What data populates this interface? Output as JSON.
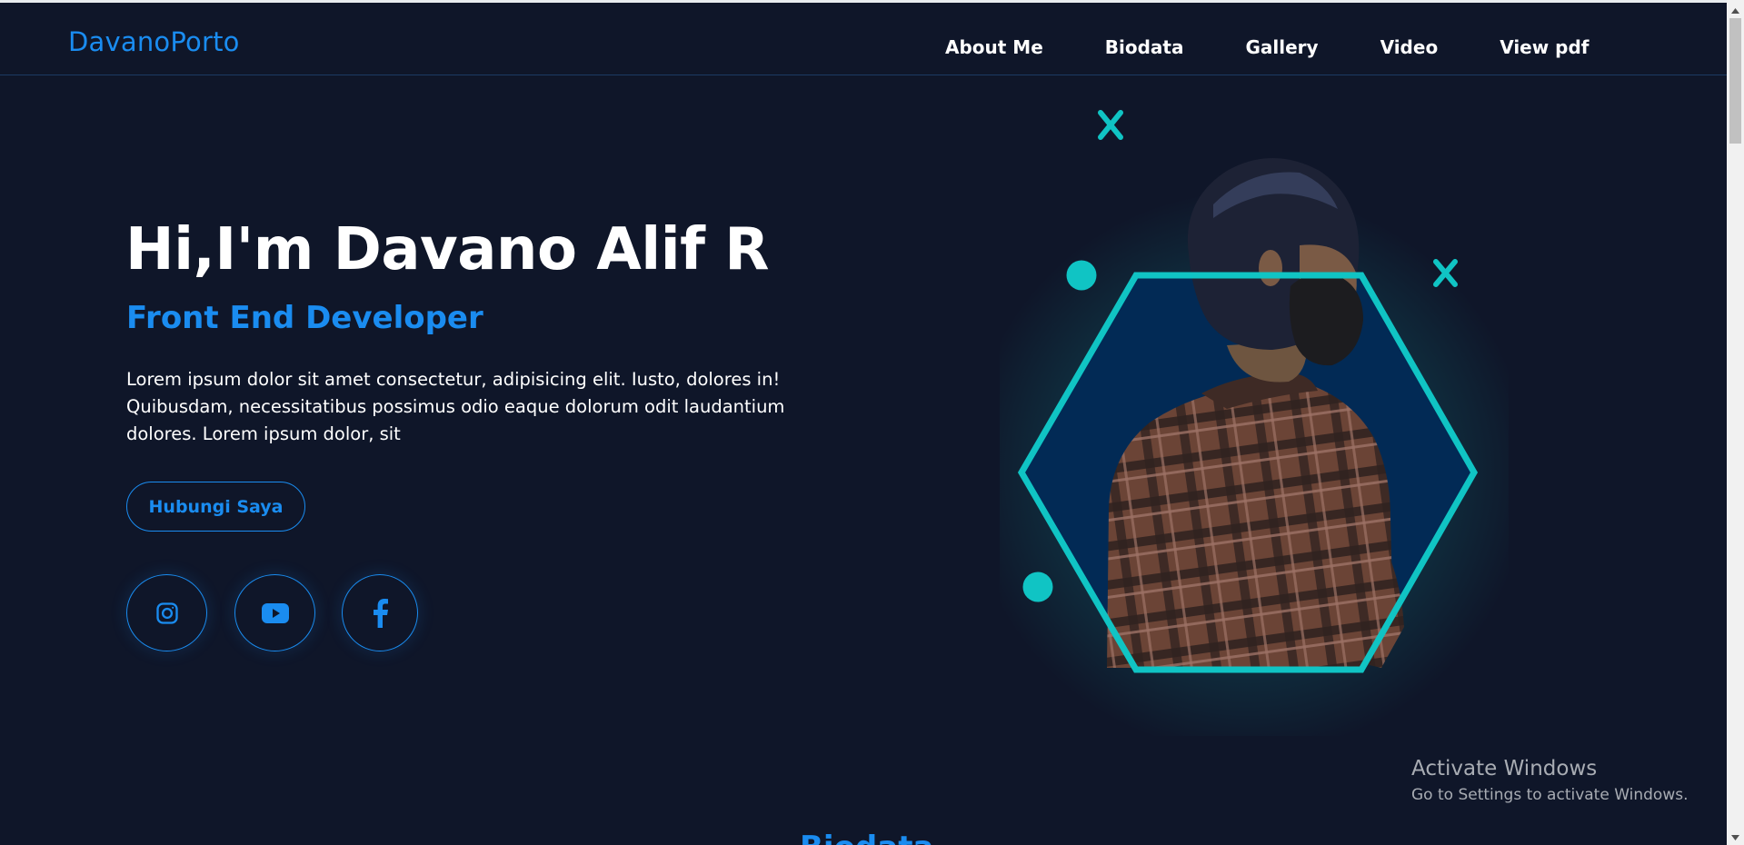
{
  "navbar": {
    "brand": "DavanoPorto",
    "links": [
      "About Me",
      "Biodata",
      "Gallery",
      "Video",
      "View pdf"
    ]
  },
  "hero": {
    "title": "Hi,I'm Davano Alif R",
    "subtitle": "Front End Developer",
    "description": "Lorem ipsum dolor sit amet consectetur, adipisicing elit. Iusto, dolores in! Quibusdam, necessitatibus possimus odio eaque dolorum odit laudantium dolores. Lorem ipsum dolor, sit",
    "contact_button": "Hubungi Saya",
    "socials": [
      "instagram-icon",
      "youtube-icon",
      "facebook-icon"
    ]
  },
  "next_section": {
    "heading": "Biodata"
  },
  "watermark": {
    "line1": "Activate Windows",
    "line2": "Go to Settings to activate Windows."
  },
  "colors": {
    "background": "#0f1629",
    "accent": "#1a8cf0",
    "teal": "#10c4c4",
    "hex_fill": "#022a55"
  }
}
